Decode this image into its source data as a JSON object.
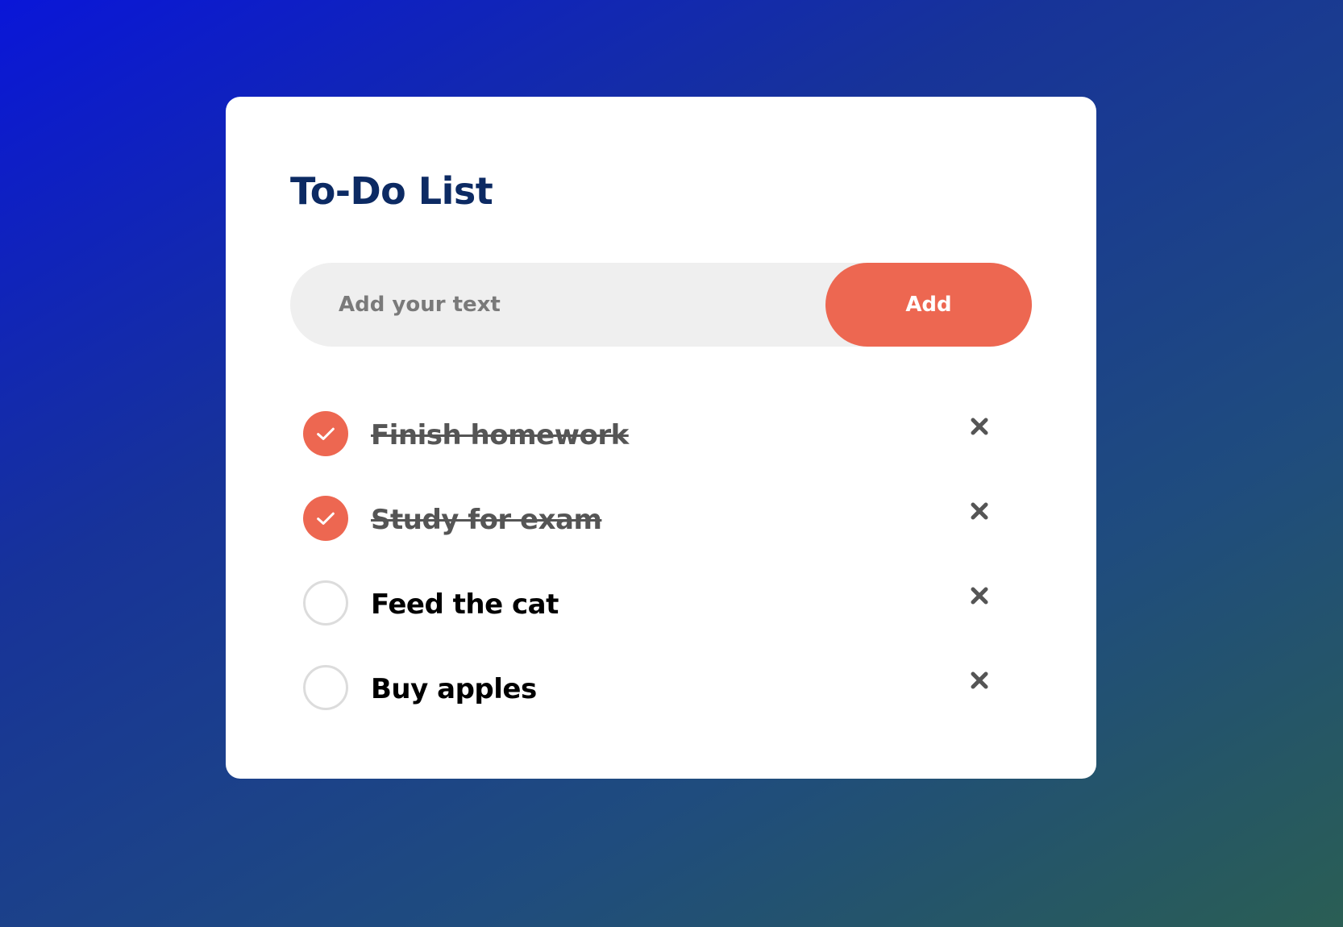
{
  "app": {
    "title": "To-Do List"
  },
  "input": {
    "placeholder": "Add your text",
    "value": ""
  },
  "add_button": {
    "label": "Add"
  },
  "todos": [
    {
      "text": "Finish homework",
      "completed": true
    },
    {
      "text": "Study for exam",
      "completed": true
    },
    {
      "text": "Feed the cat",
      "completed": false
    },
    {
      "text": "Buy apples",
      "completed": false
    }
  ],
  "icons": {
    "check": "check-icon",
    "delete": "close-icon"
  },
  "colors": {
    "accent": "#ed6751",
    "title": "#0c2a63",
    "card": "#ffffff",
    "input_bg": "#efefef",
    "completed_text": "#555555"
  }
}
